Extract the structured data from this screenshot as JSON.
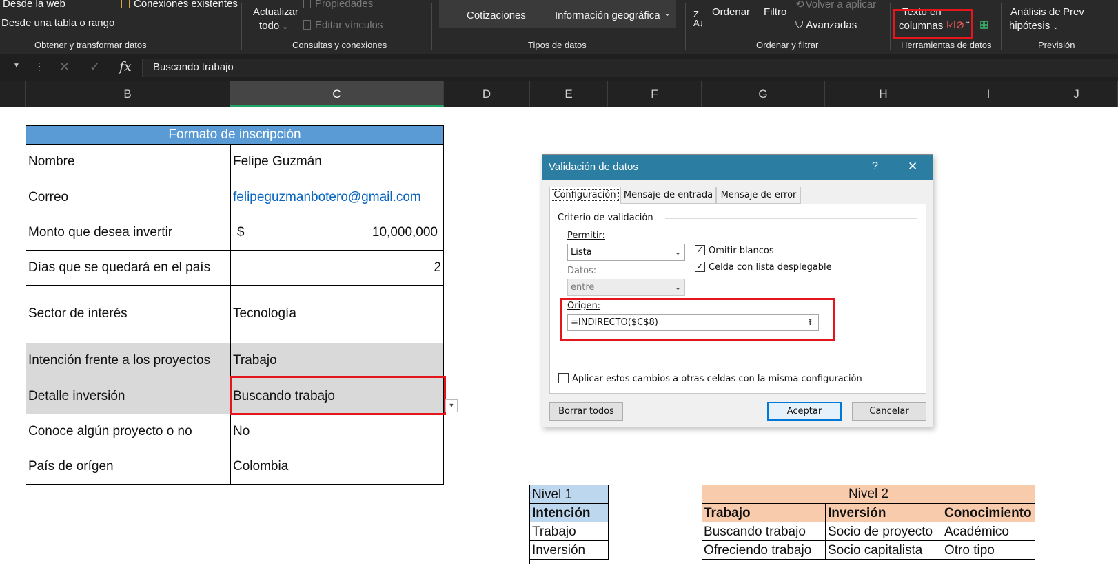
{
  "ribbon": {
    "get_data": {
      "from_web": "Desde la web",
      "from_table": "Desde una tabla o rango",
      "existing_connections": "Conexiones existentes",
      "group": "Obtener y transformar datos"
    },
    "queries": {
      "refresh_all": "Actualizar",
      "refresh_all_2": "todo",
      "properties": "Propiedades",
      "edit_links": "Editar vínculos",
      "group": "Consultas y conexiones"
    },
    "data_types": {
      "stocks": "Cotizaciones",
      "geography": "Información geográfica",
      "group": "Tipos de datos"
    },
    "sort_filter": {
      "sort": "Ordenar",
      "filter": "Filtro",
      "reapply": "Volver a aplicar",
      "advanced": "Avanzadas",
      "group": "Ordenar y filtrar"
    },
    "data_tools": {
      "text_to_columns_1": "Texto en",
      "text_to_columns_2": "columnas",
      "group": "Herramientas de datos"
    },
    "forecast": {
      "what_if_1": "Análisis de",
      "what_if_2": "hipótesis",
      "forecast_short": "Prev",
      "group": "Previsión"
    }
  },
  "formula_bar": {
    "value": "Buscando trabajo",
    "fx": "fx",
    "cancel": "✕",
    "enter": "✓"
  },
  "columns": [
    "B",
    "C",
    "D",
    "E",
    "F",
    "G",
    "H",
    "I",
    "J"
  ],
  "form": {
    "title": "Formato de inscripción",
    "rows": [
      {
        "label": "Nombre",
        "value": "Felipe Guzmán"
      },
      {
        "label": "Correo",
        "value": "felipeguzmanbotero@gmail.com"
      },
      {
        "label": "Monto que desea invertir",
        "currency": "$",
        "value": "10,000,000"
      },
      {
        "label": "Días que se quedará en el país",
        "value": "2"
      },
      {
        "label": "Sector de interés",
        "value": "Tecnología"
      },
      {
        "label": "Intención frente a los proyectos",
        "value": "Trabajo"
      },
      {
        "label": "Detalle inversión",
        "value": "Buscando trabajo"
      },
      {
        "label": "Conoce algún proyecto o no",
        "value": "No"
      },
      {
        "label": "País de orígen",
        "value": "Colombia"
      }
    ]
  },
  "level1": {
    "title": "Nivel 1",
    "header": "Intención",
    "items": [
      "Trabajo",
      "Inversión"
    ]
  },
  "level2": {
    "title": "Nivel 2",
    "headers": [
      "Trabajo",
      "Inversión",
      "Conocimiento"
    ],
    "rows": [
      [
        "Buscando trabajo",
        "Socio de proyecto",
        "Académico"
      ],
      [
        "Ofreciendo trabajo",
        "Socio capitalista",
        "Otro tipo"
      ]
    ]
  },
  "dialog": {
    "title": "Validación de datos",
    "help": "?",
    "close": "✕",
    "tabs": [
      "Configuración",
      "Mensaje de entrada",
      "Mensaje de error"
    ],
    "section": "Criterio de validación",
    "allow_label": "Permitir:",
    "allow_value": "Lista",
    "data_label": "Datos:",
    "data_value": "entre",
    "ignore_blank": "Omitir blancos",
    "in_cell_dropdown": "Celda con lista desplegable",
    "source_label": "Origen:",
    "source_value": "=INDIRECTO($C$8)",
    "apply_all": "Aplicar estos cambios a otras celdas con la misma configuración",
    "clear_all": "Borrar todos",
    "ok": "Aceptar",
    "cancel": "Cancelar"
  },
  "colors": {
    "ribbon_bg": "#292929",
    "form_header": "#5b9bd5",
    "gray_fill": "#d9d9d9",
    "level1_fill": "#bdd7ee",
    "level2_fill": "#f8cbad",
    "highlight_red": "#e4161c",
    "dialog_title": "#2b7ea2"
  }
}
